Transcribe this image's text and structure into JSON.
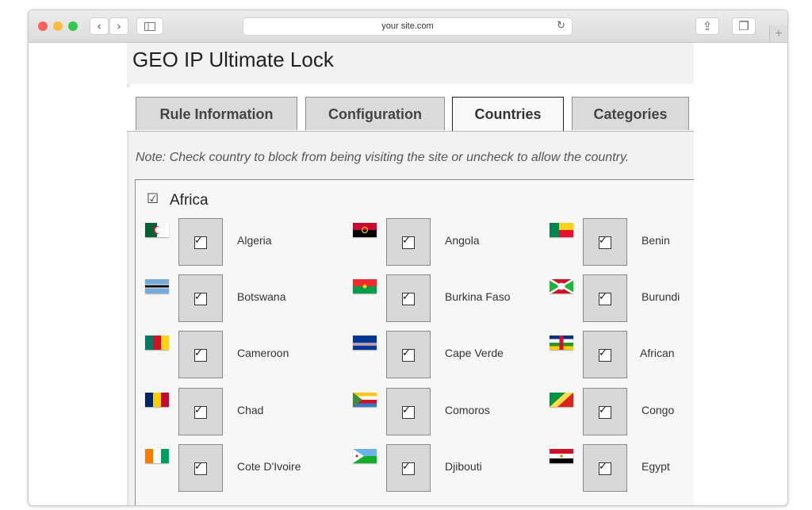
{
  "browser": {
    "url": "your site.com",
    "traffic_colors": [
      "#fc605b",
      "#fdbc40",
      "#34c84a"
    ],
    "back_glyph": "‹",
    "forward_glyph": "›",
    "reload_glyph": "↻",
    "share_glyph": "⇪",
    "tabs_glyph": "❐",
    "newtab_glyph": "+"
  },
  "page": {
    "title": "GEO IP Ultimate Lock",
    "tabs": [
      {
        "label": "Rule Information",
        "active": false
      },
      {
        "label": "Configuration",
        "active": false
      },
      {
        "label": "Countries",
        "active": true
      },
      {
        "label": "Categories",
        "active": false
      }
    ],
    "note": "Note: Check country to block from being visiting the site or uncheck to allow the country.",
    "region": {
      "name": "Africa",
      "checked": true,
      "check_glyph": "☑",
      "tick_glyph": "✓",
      "countries": [
        {
          "name": "Algeria",
          "checked": true,
          "flag": "algeria-flag"
        },
        {
          "name": "Angola",
          "checked": true,
          "flag": "angola-flag"
        },
        {
          "name": "Benin",
          "checked": true,
          "flag": "benin-flag"
        },
        {
          "name": "Botswana",
          "checked": true,
          "flag": "botswana-flag"
        },
        {
          "name": "Burkina Faso",
          "checked": true,
          "flag": "burkina-faso-flag"
        },
        {
          "name": "Burundi",
          "checked": true,
          "flag": "burundi-flag"
        },
        {
          "name": "Cameroon",
          "checked": true,
          "flag": "cameroon-flag"
        },
        {
          "name": "Cape Verde",
          "checked": true,
          "flag": "cape-verde-flag"
        },
        {
          "name": "African",
          "checked": true,
          "flag": "central-african-republic-flag"
        },
        {
          "name": "Chad",
          "checked": true,
          "flag": "chad-flag"
        },
        {
          "name": "Comoros",
          "checked": true,
          "flag": "comoros-flag"
        },
        {
          "name": "Congo",
          "checked": true,
          "flag": "congo-flag"
        },
        {
          "name": "Cote D'Ivoire",
          "checked": true,
          "flag": "cote-divoire-flag"
        },
        {
          "name": "Djibouti",
          "checked": true,
          "flag": "djibouti-flag"
        },
        {
          "name": "Egypt",
          "checked": true,
          "flag": "egypt-flag"
        }
      ]
    }
  }
}
